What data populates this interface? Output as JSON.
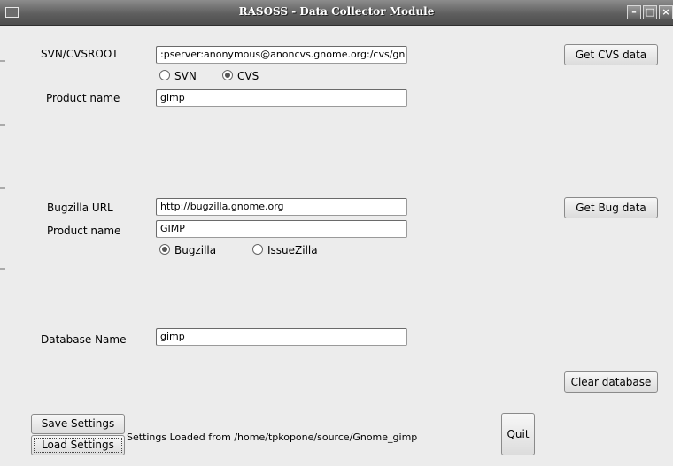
{
  "window": {
    "title": "RASOSS - Data Collector Module"
  },
  "cvs": {
    "root_label": "SVN/CVSROOT",
    "root_value": ":pserver:anonymous@anoncvs.gnome.org:/cvs/gnon",
    "svn_label": "SVN",
    "cvs_label": "CVS",
    "selected": "CVS",
    "product_label": "Product name",
    "product_value": "gimp",
    "get_button": "Get CVS data"
  },
  "bug": {
    "url_label": "Bugzilla URL",
    "url_value": "http://bugzilla.gnome.org",
    "product_label": "Product name",
    "product_value": "GIMP",
    "bugzilla_label": "Bugzilla",
    "issuezilla_label": "IssueZilla",
    "selected": "Bugzilla",
    "get_button": "Get Bug data"
  },
  "db": {
    "name_label": "Database Name",
    "name_value": "gimp",
    "clear_button": "Clear database"
  },
  "footer": {
    "save_button": "Save Settings",
    "load_button": "Load Settings",
    "status": "Settings Loaded from  /home/tpkopone/source/Gnome_gimp",
    "quit_button": "Quit"
  }
}
